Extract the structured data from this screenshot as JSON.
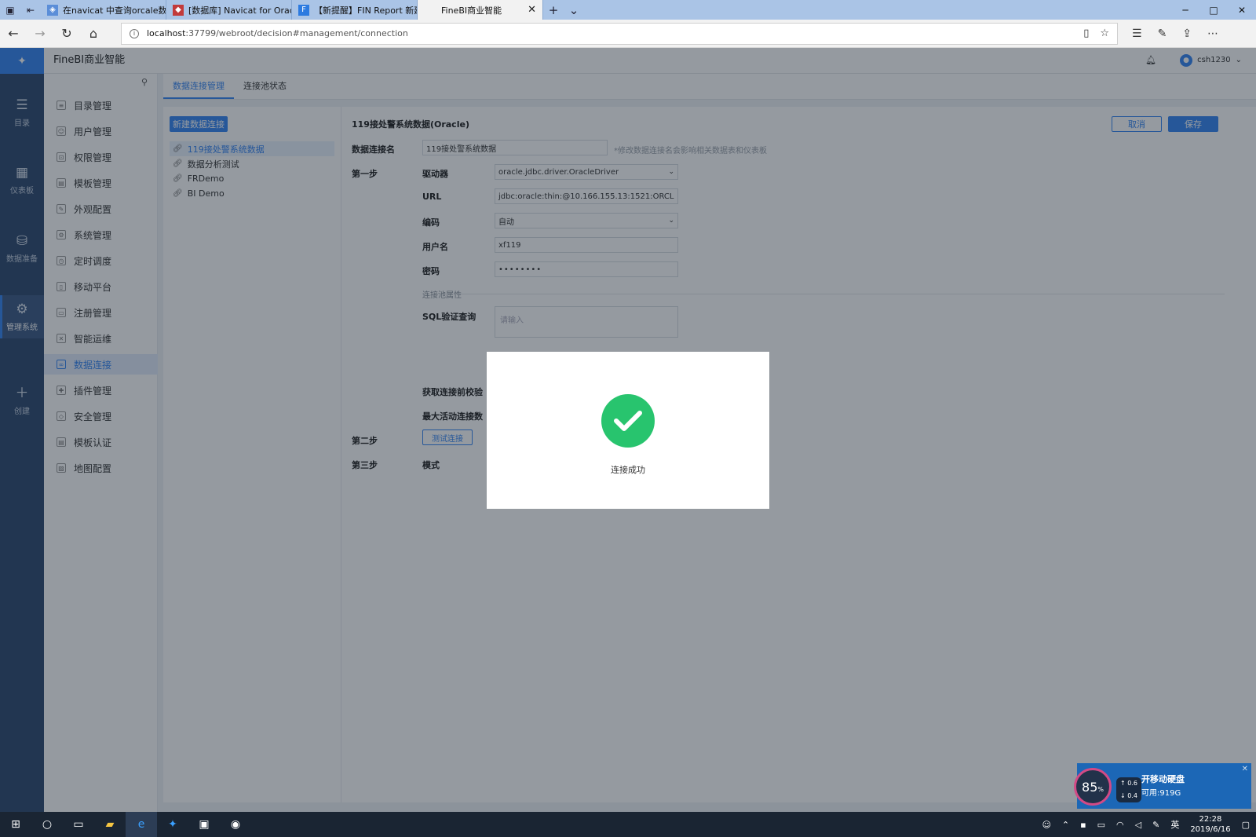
{
  "browser": {
    "tabs": [
      {
        "title": "在navicat 中查询orcale数据"
      },
      {
        "title": "[数据库] Navicat for Oracle"
      },
      {
        "title": "【新提醒】FIN Report 新建"
      },
      {
        "title": "FineBI商业智能"
      }
    ],
    "url_host": "localhost",
    "url_rest": ":37799/webroot/decision#management/connection"
  },
  "app": {
    "title": "FineBI商业智能",
    "user": "csh1230"
  },
  "leftbar": [
    {
      "label": "目录",
      "icon": "list-icon"
    },
    {
      "label": "仪表板",
      "icon": "dashboard-icon"
    },
    {
      "label": "数据准备",
      "icon": "database-icon"
    },
    {
      "label": "管理系统",
      "icon": "gear-icon"
    },
    {
      "label": "创建",
      "icon": "plus-icon"
    }
  ],
  "menu": [
    "目录管理",
    "用户管理",
    "权限管理",
    "模板管理",
    "外观配置",
    "系统管理",
    "定时调度",
    "移动平台",
    "注册管理",
    "智能运维",
    "数据连接",
    "插件管理",
    "安全管理",
    "模板认证",
    "地图配置"
  ],
  "sub_tabs": [
    "数据连接管理",
    "连接池状态"
  ],
  "connections": {
    "new_button": "新建数据连接",
    "items": [
      "119接处警系统数据",
      "数据分析测试",
      "FRDemo",
      "BI Demo"
    ]
  },
  "form": {
    "title": "119接处警系统数据(Oracle)",
    "cancel": "取消",
    "save": "保存",
    "name_label": "数据连接名",
    "name_value": "119接处警系统数据",
    "name_hint": "*修改数据连接名会影响相关数据表和仪表板",
    "step1": "第一步",
    "driver_label": "驱动器",
    "driver_value": "oracle.jdbc.driver.OracleDriver",
    "url_label": "URL",
    "url_value": "jdbc:oracle:thin:@10.166.155.13:1521:ORCL",
    "encoding_label": "编码",
    "encoding_value": "自动",
    "username_label": "用户名",
    "username_value": "xf119",
    "password_label": "密码",
    "password_value": "••••••••",
    "pool_header": "连接池属性",
    "sql_label": "SQL验证查询",
    "sql_placeholder": "请输入",
    "check_label": "获取连接前校验",
    "max_label": "最大活动连接数",
    "step2": "第二步",
    "test_button": "测试连接",
    "step3": "第三步",
    "mode_label": "模式"
  },
  "modal": {
    "message": "连接成功"
  },
  "disk_widget": {
    "percent": "85",
    "up": "0.6",
    "down": "0.4",
    "title": "开移动硬盘",
    "free": "可用:919G"
  },
  "taskbar": {
    "ime": "英",
    "time": "22:28",
    "date": "2019/6/16"
  }
}
